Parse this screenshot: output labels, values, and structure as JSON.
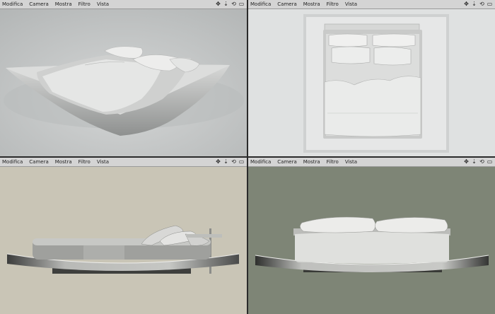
{
  "viewports": [
    {
      "menu": [
        "Modifica",
        "Camera",
        "Mostra",
        "Filtro",
        "Vista"
      ],
      "view": "perspective"
    },
    {
      "menu": [
        "Modifica",
        "Camera",
        "Mostra",
        "Filtro",
        "Vista"
      ],
      "view": "top"
    },
    {
      "menu": [
        "Modifica",
        "Camera",
        "Mostra",
        "Filtro",
        "Vista"
      ],
      "view": "side"
    },
    {
      "menu": [
        "Modifica",
        "Camera",
        "Mostra",
        "Filtro",
        "Vista"
      ],
      "view": "front"
    }
  ],
  "viewport_controls": [
    "✥",
    "⇣",
    "⟲",
    "▭"
  ],
  "colors": {
    "menubar": "#d4d4d4",
    "perspective_bg": "#c9cbcb",
    "top_bg": "#e2e4e4",
    "side_bg": "#c9c5b6",
    "front_bg": "#7e8576"
  }
}
